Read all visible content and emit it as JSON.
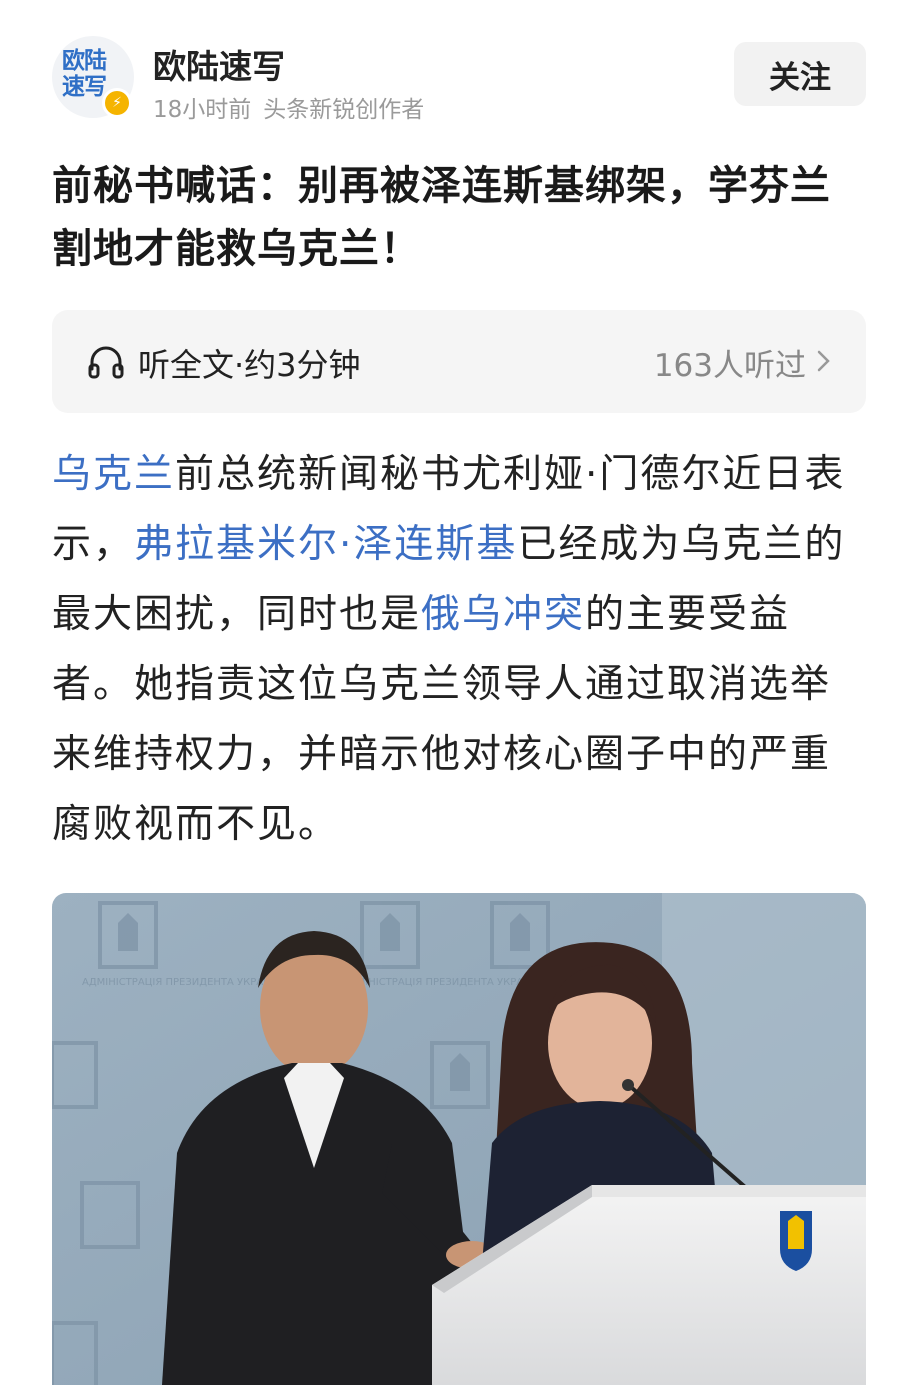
{
  "author": {
    "avatar_text": "欧陆速写",
    "name": "欧陆速写",
    "time": "18小时前",
    "role": "头条新锐创作者",
    "follow_label": "关注"
  },
  "article": {
    "title": "前秘书喊话：别再被泽连斯基绑架，学芬兰割地才能救乌克兰！",
    "listen": {
      "label": "听全文·约3分钟",
      "count": "163人听过"
    },
    "body": {
      "link1": "乌克兰",
      "t1": "前总统新闻秘书尤利娅·门德尔近日表示，",
      "link2": "弗拉基米尔·泽连斯基",
      "t2": "已经成为乌克兰的最大困扰，同时也是",
      "link3": "俄乌冲突",
      "t3": "的主要受益者。她指责这位乌克兰领导人通过取消选举来维持权力，并暗示他对核心圈子中的严重腐败视而不见。"
    },
    "photo": {
      "backdrop_text": "АДМІНІСТРАЦІЯ ПРЕЗИДЕНТА УКРАЇНИ"
    }
  },
  "colors": {
    "link": "#3c6fc4",
    "badge": "#f5b400"
  }
}
